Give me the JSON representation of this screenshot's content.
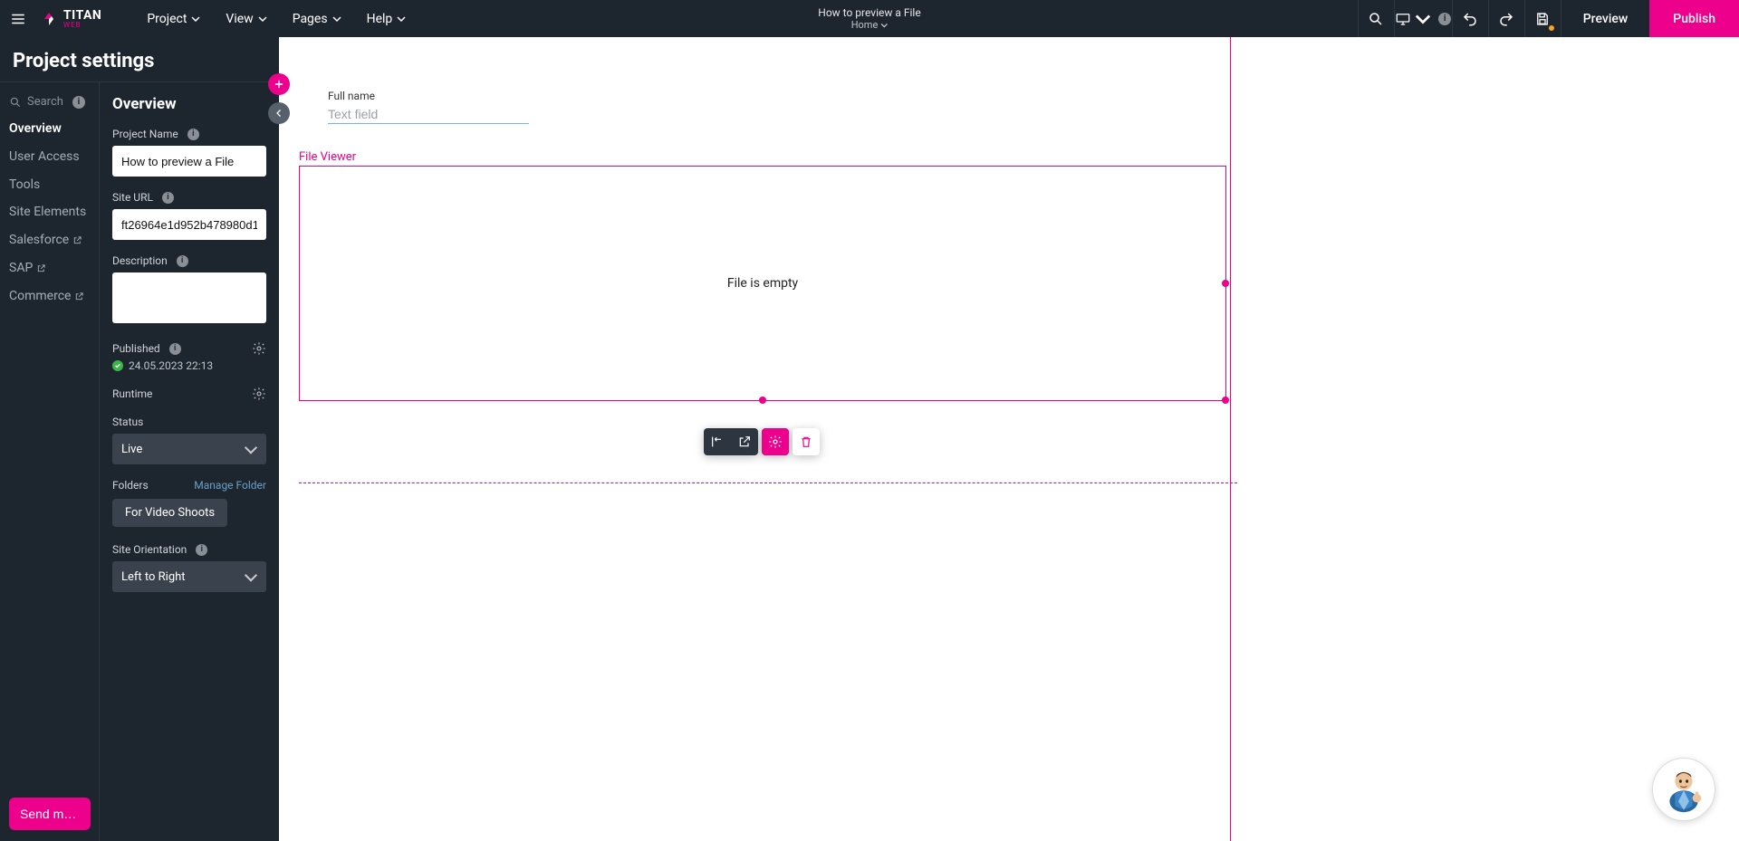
{
  "header": {
    "logo_text": "TITAN",
    "logo_sub": "WEB",
    "menu": [
      "Project",
      "View",
      "Pages",
      "Help"
    ],
    "doc_title": "How to preview a File",
    "doc_page": "Home",
    "preview": "Preview",
    "publish": "Publish"
  },
  "sidebar": {
    "title": "Project settings",
    "search_label": "Search",
    "nav": {
      "overview": "Overview",
      "user_access": "User Access",
      "tools": "Tools",
      "site_elements": "Site Elements",
      "salesforce": "Salesforce",
      "sap": "SAP",
      "commerce": "Commerce"
    },
    "send_message": "Send mes…"
  },
  "panel": {
    "heading": "Overview",
    "project_name_label": "Project Name",
    "project_name_value": "How to preview a File",
    "site_url_label": "Site URL",
    "site_url_value": "ft26964e1d952b478980d1",
    "description_label": "Description",
    "description_value": "",
    "published_label": "Published",
    "published_date": "24.05.2023 22:13",
    "runtime_label": "Runtime",
    "status_label": "Status",
    "status_value": "Live",
    "folders_label": "Folders",
    "manage_folder": "Manage Folder",
    "folder_chip": "For Video Shoots",
    "orientation_label": "Site Orientation",
    "orientation_value": "Left to Right"
  },
  "canvas": {
    "full_name_label": "Full name",
    "full_name_placeholder": "Text field",
    "file_viewer_label": "File Viewer",
    "file_viewer_empty": "File is empty"
  }
}
